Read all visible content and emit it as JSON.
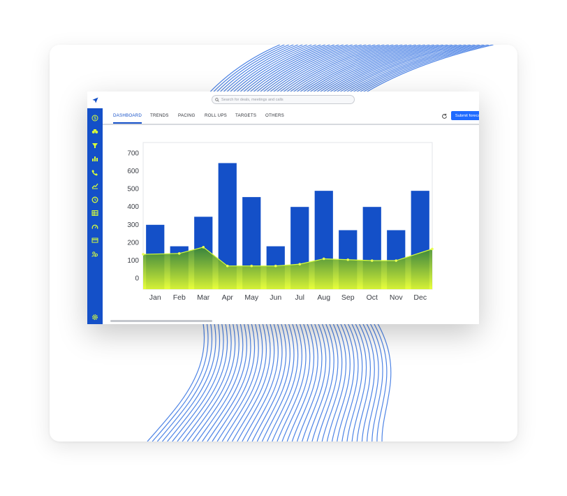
{
  "search": {
    "placeholder": "Search for deals, meetings and calls"
  },
  "sidebar": {
    "logo_icon": "navigation-arrow-icon",
    "items": [
      {
        "icon": "dollar-icon"
      },
      {
        "icon": "binoculars-icon"
      },
      {
        "icon": "funnel-icon"
      },
      {
        "icon": "bar-chart-icon"
      },
      {
        "icon": "phone-icon"
      },
      {
        "icon": "trend-chart-icon"
      },
      {
        "icon": "clock-icon"
      },
      {
        "icon": "table-icon"
      },
      {
        "icon": "gauge-icon"
      },
      {
        "icon": "card-icon"
      },
      {
        "icon": "people-icon"
      }
    ],
    "bottom_icon": "settings-icon"
  },
  "tabs": [
    {
      "label": "DASHBOARD",
      "active": true
    },
    {
      "label": "TRENDS",
      "active": false
    },
    {
      "label": "PACING",
      "active": false
    },
    {
      "label": "ROLL UPS",
      "active": false
    },
    {
      "label": "TARGETS",
      "active": false
    },
    {
      "label": "OTHERS",
      "active": false
    }
  ],
  "toolbar": {
    "submit_label": "Submit forecast",
    "refresh_icon": "refresh-icon"
  },
  "colors": {
    "sidebar": "#1450c8",
    "bar": "#1450c8",
    "area_top": "#3d8a2a",
    "area_bottom": "#e6ff2a",
    "button": "#1f6bff"
  },
  "chart_data": {
    "type": "bar",
    "categories": [
      "Jan",
      "Feb",
      "Mar",
      "Apr",
      "May",
      "Jun",
      "Jul",
      "Aug",
      "Sep",
      "Oct",
      "Nov",
      "Dec"
    ],
    "series": [
      {
        "type": "bar",
        "values": [
          300,
          180,
          345,
          645,
          455,
          180,
          400,
          490,
          270,
          400,
          270,
          490
        ]
      },
      {
        "type": "area",
        "values": [
          135,
          140,
          175,
          70,
          70,
          70,
          80,
          110,
          105,
          100,
          100,
          165
        ]
      }
    ],
    "yticks": [
      0,
      100,
      200,
      300,
      400,
      500,
      600,
      700
    ],
    "ylim": [
      -60,
      760
    ],
    "grid": false
  }
}
